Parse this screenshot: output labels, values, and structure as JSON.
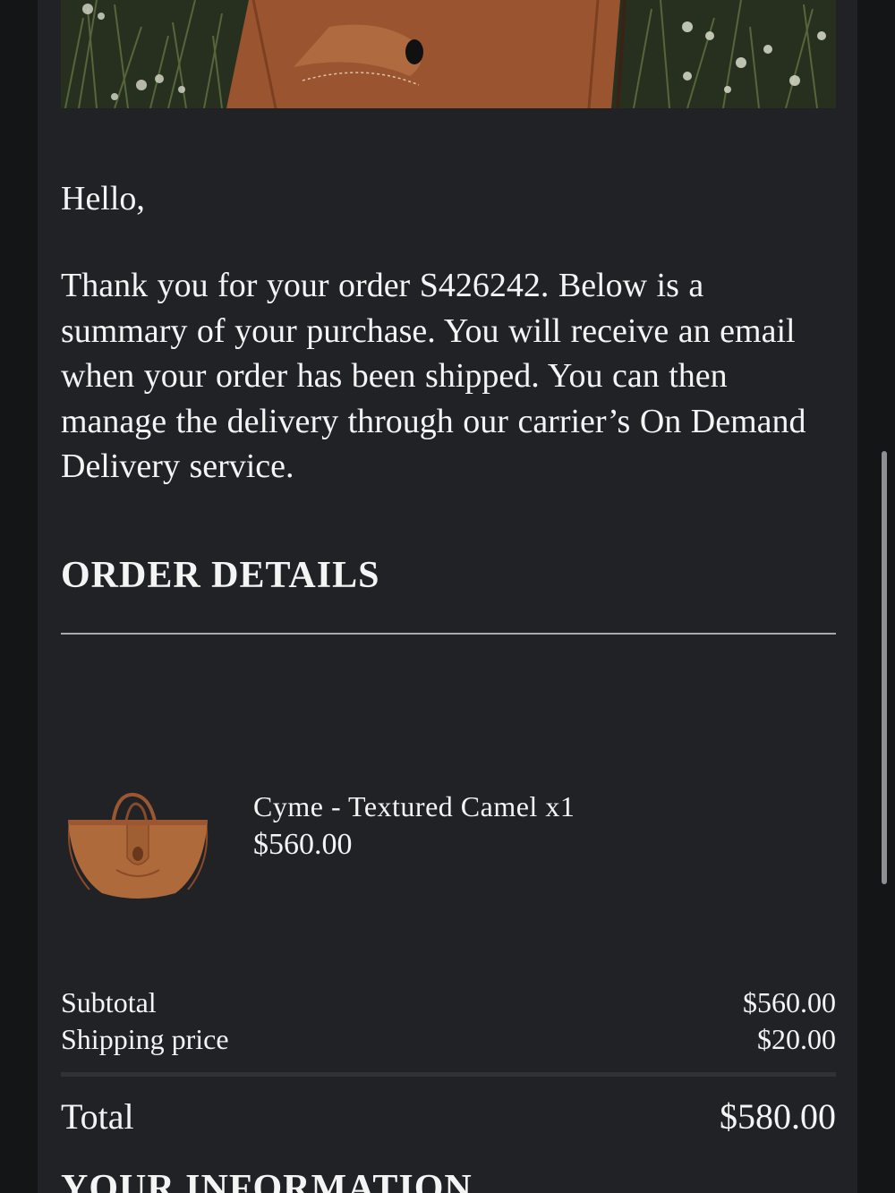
{
  "email": {
    "greeting": "Hello,",
    "intro": "Thank you for your order S426242. Below is a summary of your purchase. You will receive an email when your order has been shipped. You can then manage the delivery through our carrier’s On Demand Delivery service.",
    "order_details_title": "ORDER DETAILS",
    "item": {
      "name": "Cyme - Textured Camel x1",
      "price": "$560.00"
    },
    "summary": {
      "subtotal_label": "Subtotal",
      "subtotal_value": "$560.00",
      "shipping_label": "Shipping price",
      "shipping_value": "$20.00",
      "total_label": "Total",
      "total_value": "$580.00"
    },
    "your_information_title": "YOUR INFORMATION"
  },
  "colors": {
    "background": "#212226",
    "frame": "#141517",
    "text": "#f4f4f4",
    "rule": "#a8a9ad",
    "leather": "#a35a32"
  }
}
